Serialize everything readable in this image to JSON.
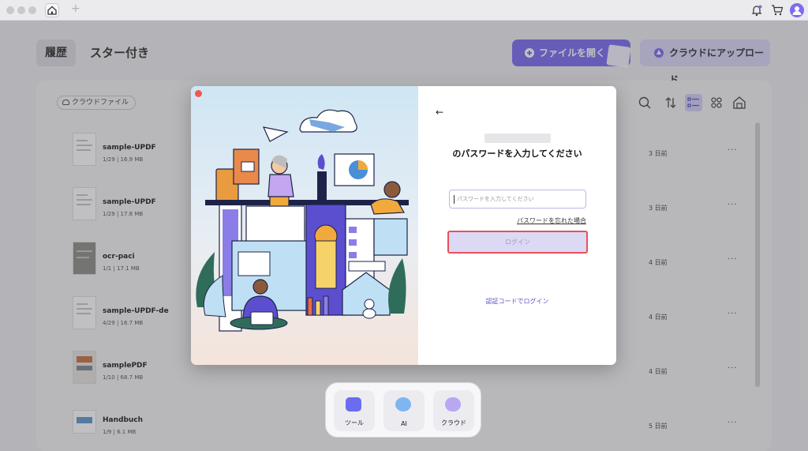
{
  "header": {
    "tab_history": "履歴",
    "tab_starred": "スター付き",
    "open_file_label": "ファイルを開く",
    "upload_cloud_label": "クラウドにアップロード"
  },
  "toolbar": {
    "cloud_files_chip": "クラウドファイル"
  },
  "files": [
    {
      "name": "sample-UPDF",
      "pages": "1/29",
      "size": "16.9 MB",
      "date": "3 日前"
    },
    {
      "name": "sample-UPDF",
      "pages": "1/29",
      "size": "17.8 MB",
      "date": "3 日前"
    },
    {
      "name": "ocr-paci",
      "pages": "1/1",
      "size": "17.1 MB",
      "date": "4 日前"
    },
    {
      "name": "sample-UPDF-de",
      "pages": "4/29",
      "size": "16.7 MB",
      "date": "4 日前"
    },
    {
      "name": "samplePDF",
      "pages": "1/10",
      "size": "68.7 MB",
      "date": "4 日前"
    },
    {
      "name": "Handbuch",
      "pages": "1/9",
      "size": "6.1 MB",
      "date": "5 日前"
    }
  ],
  "more_glyph": "···",
  "modal": {
    "back_glyph": "←",
    "title": "のパスワードを入力してください",
    "password_placeholder": "パスワードを入力してください",
    "forgot_password": "パスワードを忘れた場合",
    "login_button": "ログイン",
    "code_login": "認証コードでログイン"
  },
  "dock": {
    "tools_label": "ツール",
    "ai_label": "AI",
    "cloud_label": "クラウド"
  },
  "colors": {
    "accent": "#7b6ef0",
    "accent_light": "#dad6f8",
    "highlight_border": "#e6525a"
  },
  "icons": [
    "home-icon",
    "plus-icon",
    "bell-icon",
    "cart-icon",
    "user-icon",
    "search-icon",
    "sort-icon",
    "list-view-icon",
    "grid-view-icon",
    "batch-icon"
  ]
}
